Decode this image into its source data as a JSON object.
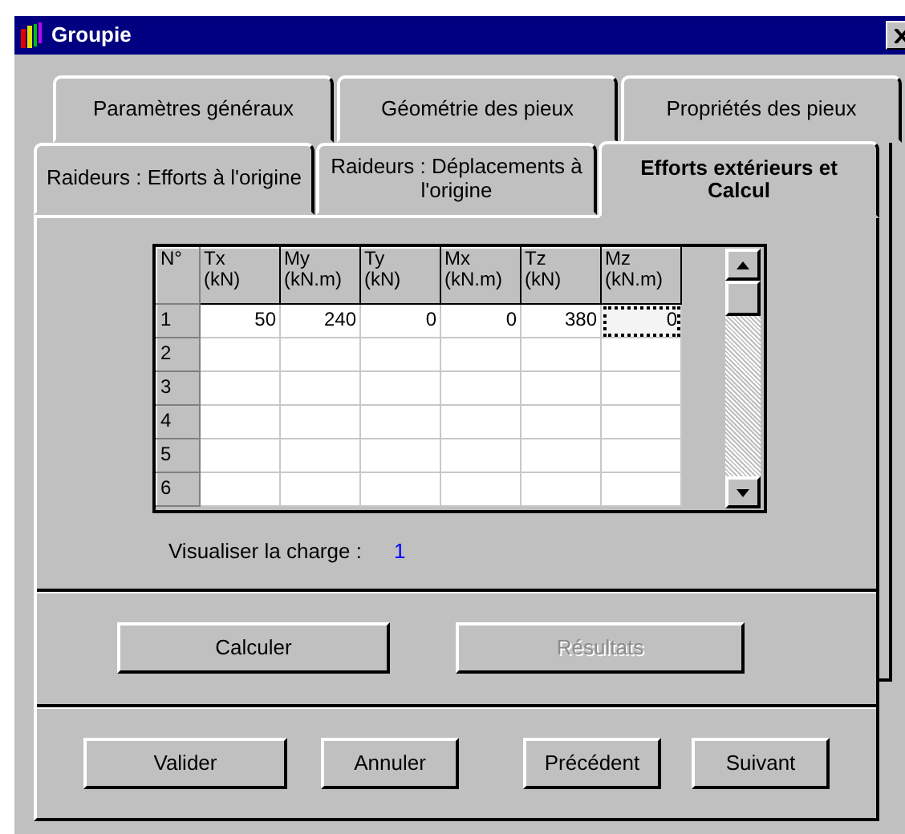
{
  "window": {
    "title": "Groupie"
  },
  "tab_rows": [
    [
      {
        "label": "Paramètres généraux",
        "selected": false
      },
      {
        "label": "Géométrie des pieux",
        "selected": false
      },
      {
        "label": "Propriétés des pieux",
        "selected": false
      }
    ],
    [
      {
        "label": "Raideurs : Efforts à l'origine",
        "selected": false
      },
      {
        "label": "Raideurs : Déplacements à l'origine",
        "selected": false
      },
      {
        "label": "Efforts extérieurs et Calcul",
        "selected": true
      }
    ]
  ],
  "grid": {
    "columns": [
      {
        "label": "N°"
      },
      {
        "label": "Tx\n(kN)"
      },
      {
        "label": "My\n(kN.m)"
      },
      {
        "label": "Ty\n(kN)"
      },
      {
        "label": "Mx\n(kN.m)"
      },
      {
        "label": "Tz\n(kN)"
      },
      {
        "label": "Mz\n(kN.m)"
      }
    ],
    "rows": [
      {
        "number": "1",
        "cells": [
          {
            "value": "50",
            "focused": false
          },
          {
            "value": "240",
            "focused": false
          },
          {
            "value": "0",
            "focused": false
          },
          {
            "value": "0",
            "focused": false
          },
          {
            "value": "380",
            "focused": false
          },
          {
            "value": "0",
            "focused": true
          }
        ]
      },
      {
        "number": "2"
      },
      {
        "number": "3"
      },
      {
        "number": "4"
      },
      {
        "number": "5"
      },
      {
        "number": "6"
      }
    ]
  },
  "load_display": {
    "label": "Visualiser la charge :",
    "value": "1"
  },
  "action_buttons": [
    {
      "label": "Calculer",
      "disabled": false
    },
    {
      "label": "Résultats",
      "disabled": true
    }
  ],
  "nav_buttons": [
    {
      "label": "Valider",
      "disabled": false
    },
    {
      "label": "Annuler",
      "disabled": false
    },
    {
      "label": "Précédent",
      "disabled": false
    },
    {
      "label": "Suivant",
      "disabled": false
    }
  ]
}
